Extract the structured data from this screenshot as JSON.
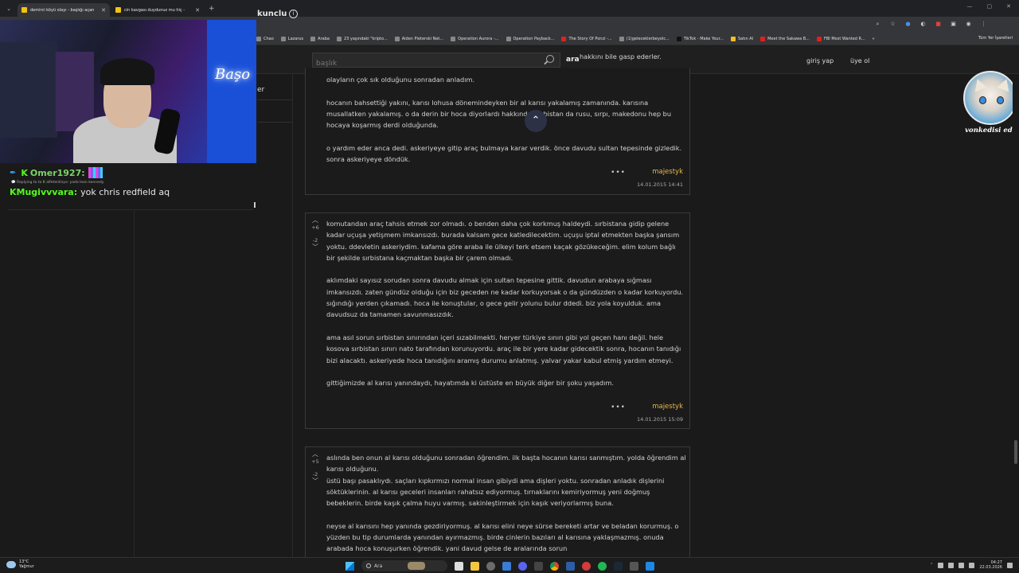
{
  "browser": {
    "tabs": [
      {
        "title": "demirci köyü olayı - başlığı açan",
        "active": true
      },
      {
        "title": "cin kavgası duydunuz mu hiç -",
        "active": false
      }
    ],
    "bookmarks": [
      "Chao",
      "Lazarus",
      "Araba",
      "23 yaşındaki \"kripto...",
      "Aiden Pleterski Net...",
      "Operation Aurora -...",
      "Operation Payback...",
      "The Story Of Ponzi -...",
      "(1)geleceklerbeyolc...",
      "TikTok - Make Your...",
      "Satın Al",
      "Meet the Sakawa B...",
      "FBI Most Wanted R..."
    ],
    "bookmarks_all": "Tüm Yer İşaretleri"
  },
  "site": {
    "brand_fragment": "kunclu",
    "search_placeholder": "başlık",
    "search_button": "ara",
    "login": "giriş yap",
    "signup": "üye ol",
    "sidebar_fragment": "er",
    "partial_text_line": "hakkını bile gasp ederler."
  },
  "entries": [
    {
      "paragraphs": [
        "olayların çok sık olduğunu sonradan anladım.",
        "hocanın bahsettiği yakını, karısı lohusa dönemindeyken bir al karısı yakalamış zamanında. karısına musallatken yakalamış. o da derin bir hoca diyorlardı hakkında. sırbistan da rusu, sırpı, makedonu hep bu hocaya koşarmış derdi olduğunda.",
        "o yardım eder anca dedi. askeriyeye gitip araç bulmaya karar verdik. önce davudu sultan tepesinde gizledik. sonra askeriyeye döndük."
      ],
      "author": "majestyk",
      "date": "14.01.2015 14:41"
    },
    {
      "upvotes": "+6",
      "downvotes": "-2",
      "paragraphs": [
        "komutandan araç tahsis etmek zor olmadı. o benden daha çok korkmuş haldeydi. sırbistana gidip gelene kadar uçuşa yetişmem imkansızdı. burada kalsam gece katledilecektim. uçuşu iptal etmekten başka şansım yoktu. ddevletin askeriydim. kafama göre araba ile ülkeyi terk etsem kaçak gözükeceğim. elim kolum bağlı bir şekilde sırbistana kaçmaktan başka bir çarem olmadı.",
        "aklımdaki sayısız sorudan sonra davudu almak için sultan tepesine gittik. davudun arabaya sığması imkansızdı. zaten gündüz olduğu için biz geceden ne kadar korkuyorsak o da gündüzden o kadar korkuyordu. sığındığı yerden çıkamadı. hoca ile konuştular, o gece gelir yolunu bulur ddedi. biz yola koyulduk. ama davudsuz da tamamen savunmasızdık.",
        "ama asıl sorun sırbistan sınırından içeri sızabilmekti. heryer türkiye sınırı gibi yol geçen hanı değil. hele kosova sırbistan sınırı nato tarafından korunuyordu. araç ile bir yere kadar gidecektik sonra, hocanın tanıdığı bizi alacaktı. askeriyede hoca tanıdığını aramış durumu anlatmış. yalvar yakar kabul etmiş yardım etmeyi.",
        "gittiğimizde al karısı yanındaydı, hayatımda ki üstüste en büyük diğer bir şoku yaşadım."
      ],
      "author": "majestyk",
      "date": "14.01.2015 15:09"
    },
    {
      "upvotes": "+5",
      "downvotes": "-2",
      "paragraphs": [
        "aslında ben onun al karısı olduğunu sonradan öğrendim. ilk başta hocanın karısı sanmıştım. yolda öğrendim al karısı olduğunu.\nüstü başı pasaklıydı. saçları kıpkırmızı normal insan gibiydi ama dişleri yoktu. sonradan anladık dişlerini söktüklerinin. al karısı geceleri insanları rahatsız ediyormuş. tırnaklarını kemiriyormuş yeni doğmuş bebeklerin. birde kaşık çalma huyu varmış. sakinleştirmek için kaşık veriyorlarmış buna.",
        "neyse al karısını hep yanında gezdiriyormuş. al karısı elini neye sürse bereketi artar ve beladan korurmuş. o yüzden bu tip durumlarda yanından ayırmazmış. birde cinlerin bazıları al karısına yaklaşmazmış. onuda arabada hoca konuşurken öğrendik. yani davud gelse de aralarında sorun"
      ]
    }
  ],
  "stream": {
    "neon_sign": "Başo",
    "chat": [
      {
        "user": "Omer1927",
        "text": ""
      },
      {
        "reply": "Replying to",
        "reply_user": "alfetenlinyo",
        "reply_text": "yada leon kennedy"
      },
      {
        "user": "Mugivvvara",
        "text": "yok chris redfield aq"
      }
    ],
    "overlay_caption": "vonkedisi edu"
  },
  "taskbar": {
    "weather_temp": "13°C",
    "weather_desc": "Yağmur",
    "search": "Ara",
    "time": "04:27",
    "date": "22.03.2026"
  }
}
